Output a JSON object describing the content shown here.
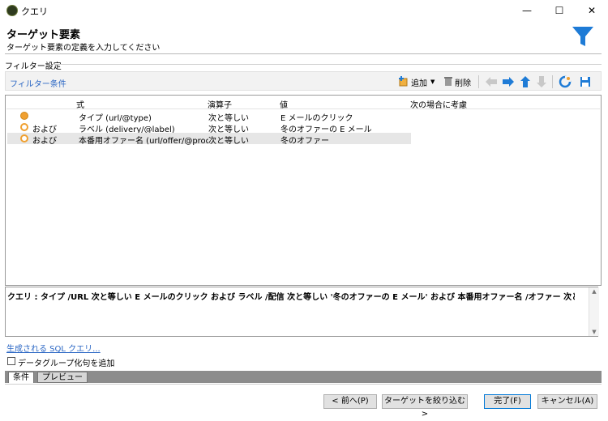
{
  "window": {
    "title": "クエリ",
    "minimize": "—",
    "maximize": "☐",
    "close": "✕"
  },
  "header": {
    "title": "ターゲット要素",
    "subtitle": "ターゲット要素の定義を入力してください"
  },
  "filter_settings": {
    "legend": "フィルター設定",
    "filter_conditions_link": "フィルター条件"
  },
  "toolbar": {
    "add_label": "追加",
    "delete_label": "削除"
  },
  "table": {
    "headers": [
      "式",
      "演算子",
      "値",
      "次の場合に考慮"
    ],
    "rows": [
      {
        "conj": "",
        "expr": "タイプ (url/@type)",
        "op": "次と等しい",
        "value": "E メールのクリック",
        "cond": "",
        "selected": false
      },
      {
        "conj": "および",
        "expr": "ラベル (delivery/@label)",
        "op": "次と等しい",
        "value": "冬のオファーの E メール",
        "cond": "",
        "selected": false
      },
      {
        "conj": "および",
        "expr": "本番用オファー名 (url/offer/@prodOf...",
        "op": "次と等しい",
        "value": "冬のオファー",
        "cond": "",
        "selected": true
      }
    ]
  },
  "query": {
    "text": "クエリ : タイプ /URL 次と等しい E メールのクリック および ラベル /配信 次と等しい '冬のオファーの E メール' および 本番用オファー名 /オファー 次と等しい '冬のオファー'"
  },
  "sql_link": "生成される SQL クエリ...",
  "checkbox_label": "データグループ化句を追加",
  "tabs": [
    "条件",
    "プレビュー"
  ],
  "buttons": {
    "back": "< 前へ(P)",
    "narrow": "ターゲットを絞り込む >",
    "finish": "完了(F)",
    "cancel": "キャンセル(A)"
  },
  "colors": {
    "accent_blue": "#1e7bd6",
    "link": "#2a66c4",
    "condition_dot": "#f0a030"
  }
}
